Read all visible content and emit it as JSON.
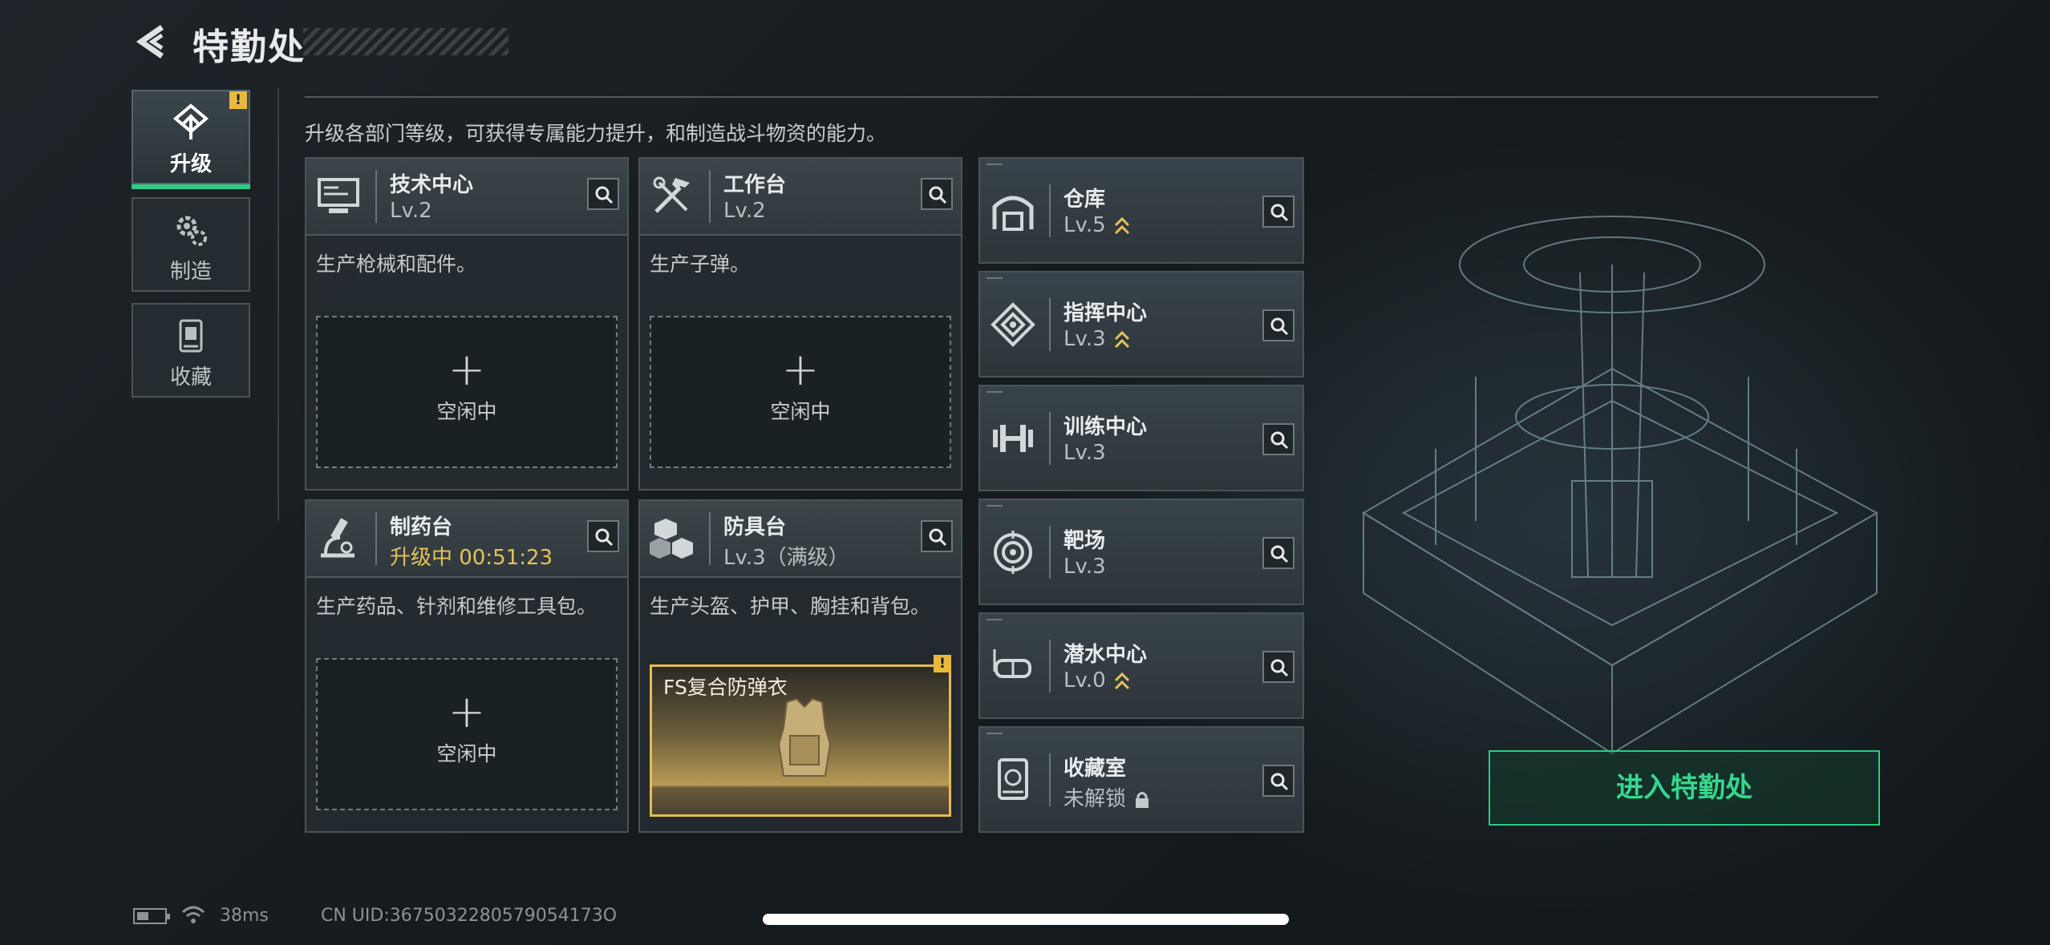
{
  "header": {
    "title": "特勤处",
    "back_icon": "back-arrow-icon"
  },
  "nav": [
    {
      "label": "升级",
      "icon": "upgrade-icon",
      "active": true,
      "alert": "!"
    },
    {
      "label": "制造",
      "icon": "gears-icon",
      "active": false
    },
    {
      "label": "收藏",
      "icon": "collection-icon",
      "active": false
    }
  ],
  "intro": "升级各部门等级，可获得专属能力提升，和制造战斗物资的能力。",
  "departments": [
    {
      "name": "技术中心",
      "level": "Lv.2",
      "desc": "生产枪械和配件。",
      "slot_plus": "+",
      "slot_status": "空闲中"
    },
    {
      "name": "工作台",
      "level": "Lv.2",
      "desc": "生产子弹。",
      "slot_plus": "+",
      "slot_status": "空闲中"
    },
    {
      "name": "制药台",
      "level": "升级中 00:51:23",
      "desc": "生产药品、针剂和维修工具包。",
      "slot_plus": "+",
      "slot_status": "空闲中"
    },
    {
      "name": "防具台",
      "level": "Lv.3（满级）",
      "desc": "生产头盔、护甲、胸挂和背包。",
      "item_name": "FS复合防弹衣",
      "item_alert": "!"
    }
  ],
  "facilities": [
    {
      "name": "仓库",
      "level": "Lv.5",
      "upgradable": true
    },
    {
      "name": "指挥中心",
      "level": "Lv.3",
      "upgradable": true
    },
    {
      "name": "训练中心",
      "level": "Lv.3",
      "upgradable": false
    },
    {
      "name": "靶场",
      "level": "Lv.3",
      "upgradable": false
    },
    {
      "name": "潜水中心",
      "level": "Lv.0",
      "upgradable": true
    },
    {
      "name": "收藏室",
      "level": "未解锁",
      "locked": true
    }
  ],
  "enter_button": "进入特勤处",
  "status": {
    "ping": "38ms",
    "uid": "CN UID:3675032280579054173O"
  },
  "colors": {
    "accent": "#2ecb85",
    "upgrade": "#e7c25a",
    "alert": "#e8b93e"
  }
}
